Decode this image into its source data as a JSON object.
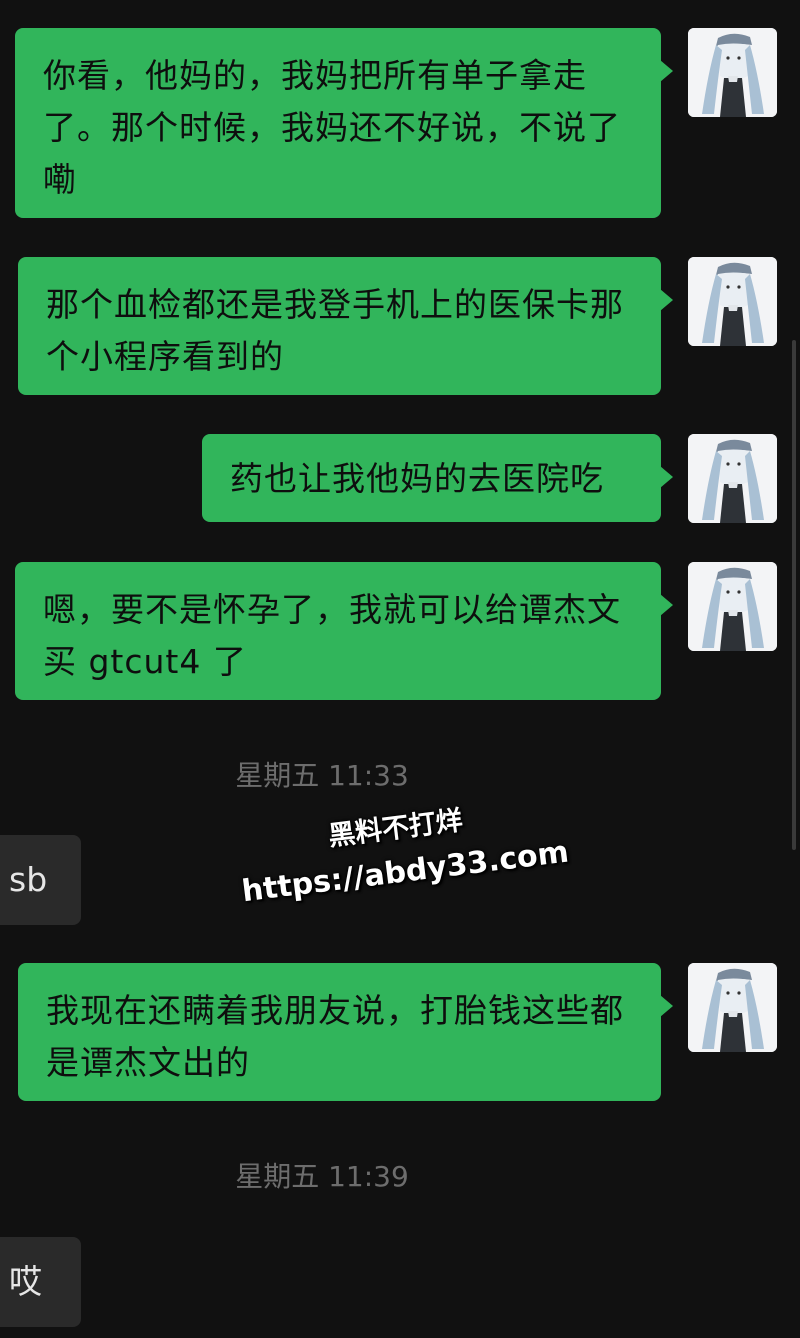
{
  "conversation": {
    "messages": [
      {
        "id": "m1",
        "side": "outgoing",
        "text": "你看，他妈的，我妈把所有单子拿走了。那个时候，我妈还不好说，不说了嘞"
      },
      {
        "id": "m2",
        "side": "outgoing",
        "text": "那个血检都还是我登手机上的医保卡那个小程序看到的"
      },
      {
        "id": "m3",
        "side": "outgoing",
        "text": "药也让我他妈的去医院吃"
      },
      {
        "id": "m4",
        "side": "outgoing",
        "text": "嗯，要不是怀孕了，我就可以给谭杰文买 gtcut4 了"
      },
      {
        "id": "m5",
        "side": "incoming",
        "text": "sb"
      },
      {
        "id": "m6",
        "side": "outgoing",
        "text": "我现在还瞒着我朋友说，打胎钱这些都是谭杰文出的"
      },
      {
        "id": "m7",
        "side": "incoming",
        "text": "哎"
      }
    ],
    "timestamps": [
      {
        "id": "t1",
        "text": "星期五 11:33"
      },
      {
        "id": "t2",
        "text": "星期五 11:39"
      }
    ]
  },
  "watermark": {
    "line1": "黑料不打烊",
    "line2": "https://abdy33.com"
  },
  "avatar_icon": "anime-girl-avatar",
  "colors": {
    "background": "#111111",
    "outgoing_bubble": "#31b55b",
    "incoming_bubble": "#2a2a2a",
    "timestamp_text": "#6d6d6d"
  }
}
